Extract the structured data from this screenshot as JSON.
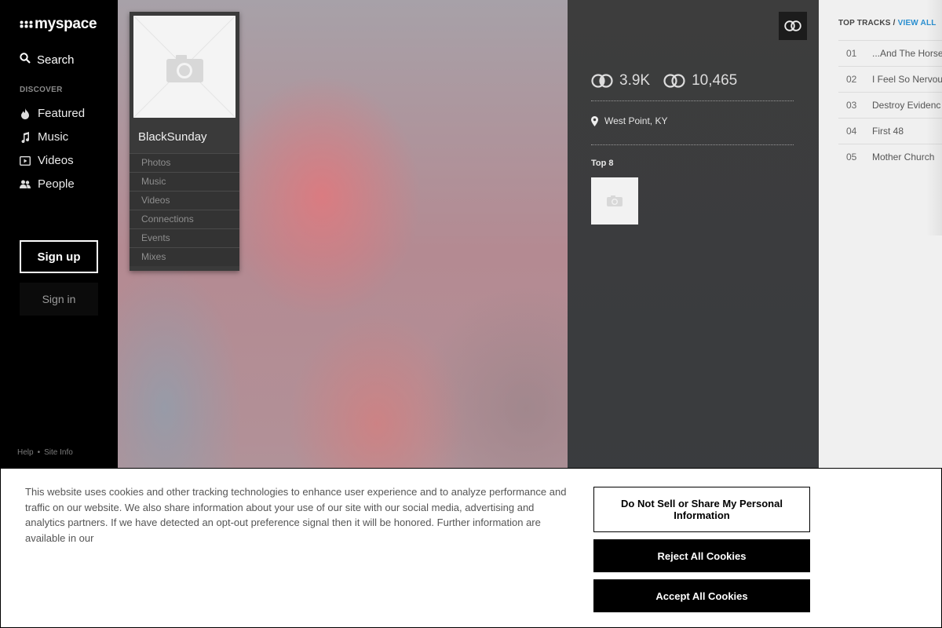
{
  "nav": {
    "logo_text": "myspace",
    "search_label": "Search",
    "discover_heading": "DISCOVER",
    "items": [
      {
        "label": "Featured",
        "icon": "flame-icon"
      },
      {
        "label": "Music",
        "icon": "music-note-icon"
      },
      {
        "label": "Videos",
        "icon": "video-play-icon"
      },
      {
        "label": "People",
        "icon": "people-icon"
      }
    ],
    "signup_label": "Sign up",
    "signin_label": "Sign in",
    "footer_links": [
      "Help",
      "Site Info"
    ]
  },
  "profile": {
    "name": "BlackSunday",
    "menu": [
      "Photos",
      "Music",
      "Videos",
      "Connections",
      "Events",
      "Mixes"
    ]
  },
  "stats": {
    "connections_in": "3.9K",
    "connections_out": "10,465",
    "location": "West Point, KY",
    "top8_label": "Top 8"
  },
  "tracks": {
    "heading": "TOP TRACKS /",
    "view_all": "VIEW ALL",
    "items": [
      {
        "num": "01",
        "title": "...And The Horse"
      },
      {
        "num": "02",
        "title": "I Feel So Nervou"
      },
      {
        "num": "03",
        "title": "Destroy Evidenc"
      },
      {
        "num": "04",
        "title": "First 48"
      },
      {
        "num": "05",
        "title": "Mother Church"
      }
    ]
  },
  "cookie": {
    "text": "This website uses cookies and other tracking technologies to enhance user experience and to analyze performance and traffic on our website. We also share information about your use of our site with our social media, advertising and analytics partners. If we have detected an opt-out preference signal then it will be honored. Further information are available in our",
    "do_not_sell": "Do Not Sell or Share My Personal Information",
    "reject": "Reject All Cookies",
    "accept": "Accept All Cookies"
  },
  "colors": {
    "accent_link": "#2a8fd0",
    "nav_bg": "#000000",
    "midcol_bg": "#3d3d3d"
  }
}
